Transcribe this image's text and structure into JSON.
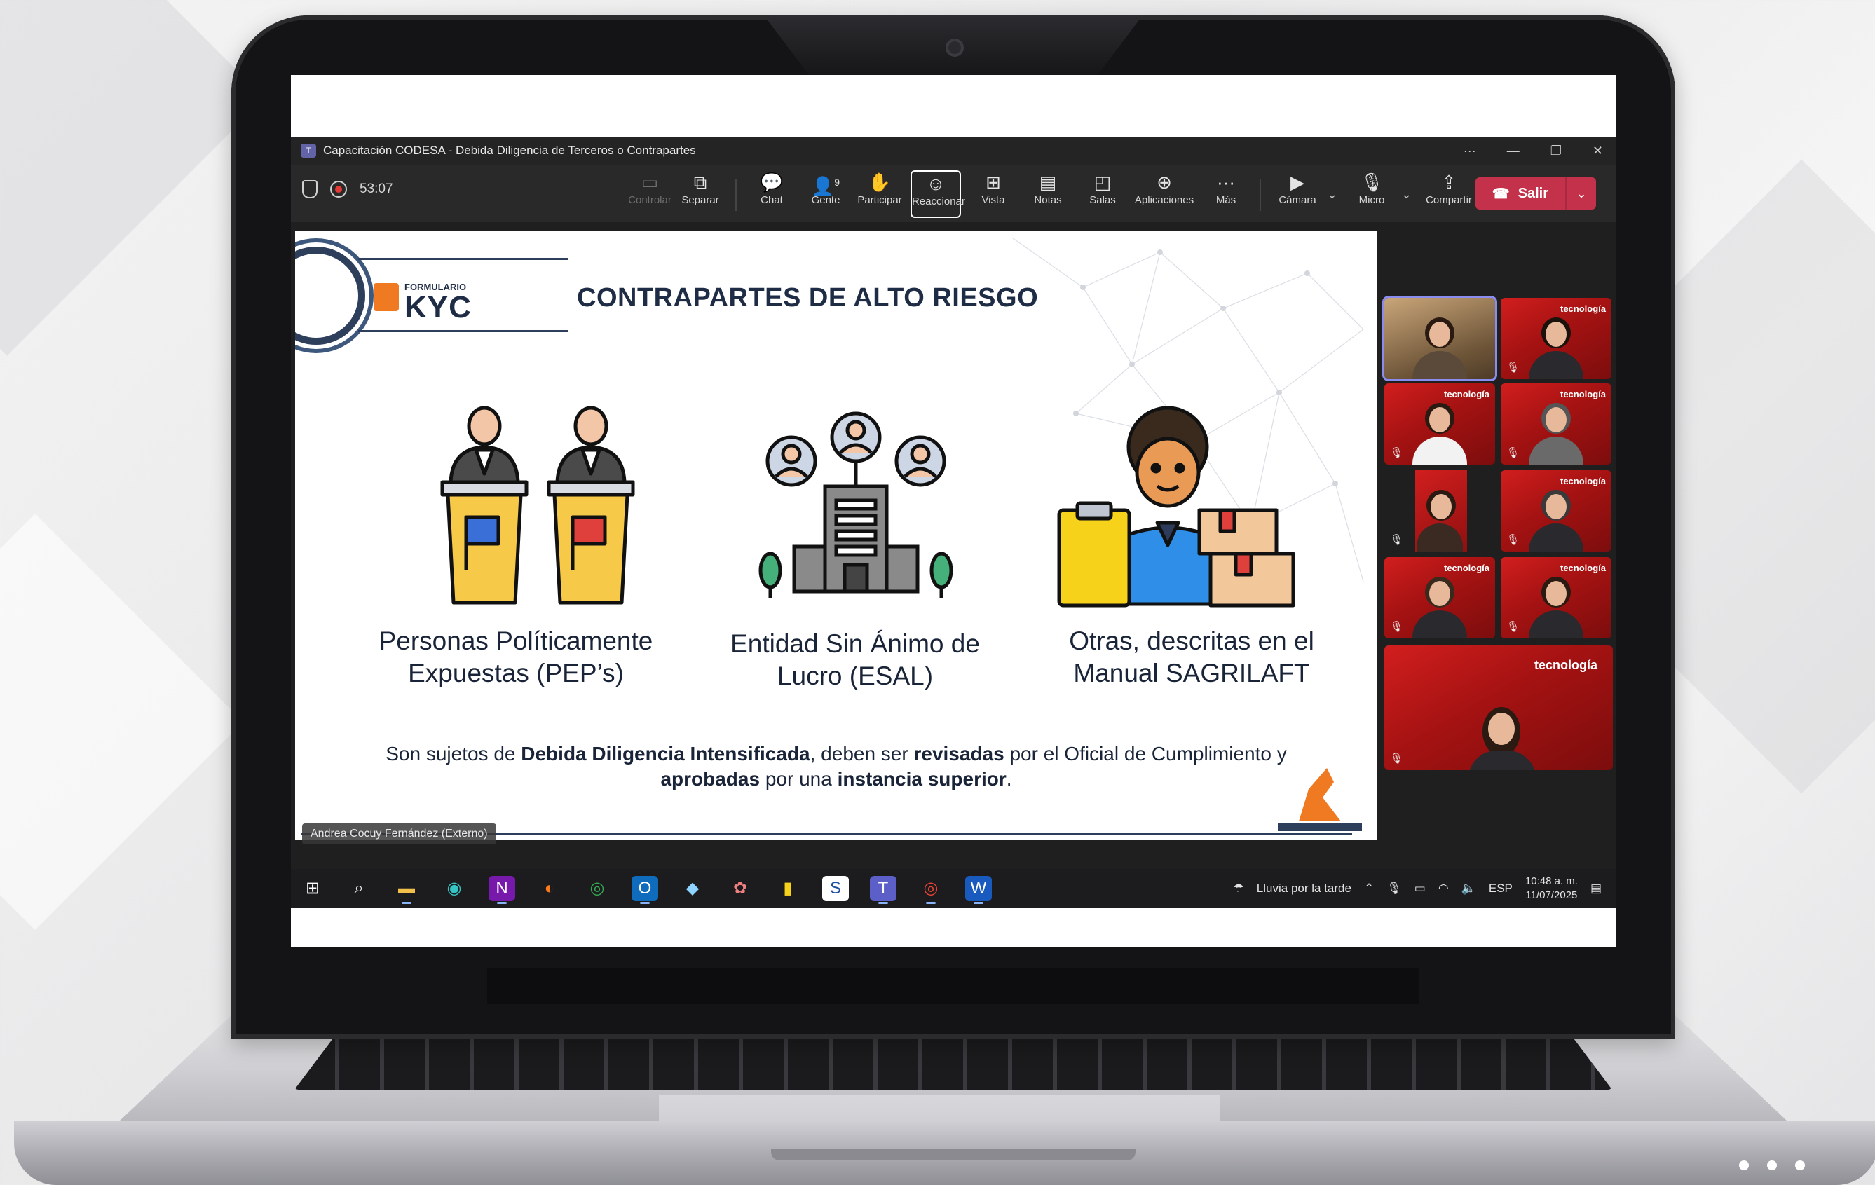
{
  "window": {
    "title": "Capacitación CODESA - Debida Diligencia de Terceros o Contrapartes",
    "more_icon": "ellipsis-icon",
    "minimize_icon": "minimize-icon",
    "restore_icon": "restore-icon",
    "close_icon": "close-icon"
  },
  "meeting": {
    "timer": "53:07",
    "toolbar": {
      "controlar": "Controlar",
      "separar": "Separar",
      "chat": "Chat",
      "gente": "Gente",
      "gente_count": "9",
      "participar": "Participar",
      "reaccionar": "Reaccionar",
      "vista": "Vista",
      "notas": "Notas",
      "salas": "Salas",
      "aplicaciones": "Aplicaciones",
      "mas": "Más",
      "camara": "Cámara",
      "micro": "Micro",
      "compartir": "Compartir",
      "salir": "Salir"
    },
    "presenter_name": "Andrea Cocuy Fernández (Externo)",
    "participant_brand": "tecnología",
    "accent_color": "#c4314b"
  },
  "slide": {
    "logo_small": "FORMULARIO",
    "logo_big": "KYC",
    "title": "CONTRAPARTES DE ALTO RIESGO",
    "columns": [
      {
        "label_line1": "Personas Políticamente",
        "label_line2": "Expuestas (PEP’s)"
      },
      {
        "label_line1": "Entidad Sin Ánimo de",
        "label_line2": "Lucro (ESAL)"
      },
      {
        "label_line1": "Otras, descritas en el",
        "label_line2": "Manual SAGRILAFT"
      }
    ],
    "footer": {
      "t1": "Son sujetos de ",
      "b1": "Debida Diligencia Intensificada",
      "t2": ", deben ser ",
      "b2": "revisadas",
      "t3": " por el Oficial de Cumplimiento y",
      "b3": "aprobadas",
      "t4": " por una ",
      "b4": "instancia superior",
      "t5": "."
    }
  },
  "taskbar": {
    "weather": "Lluvia por la tarde",
    "language": "ESP",
    "time": "10:48 a. m.",
    "date": "11/07/2025"
  }
}
